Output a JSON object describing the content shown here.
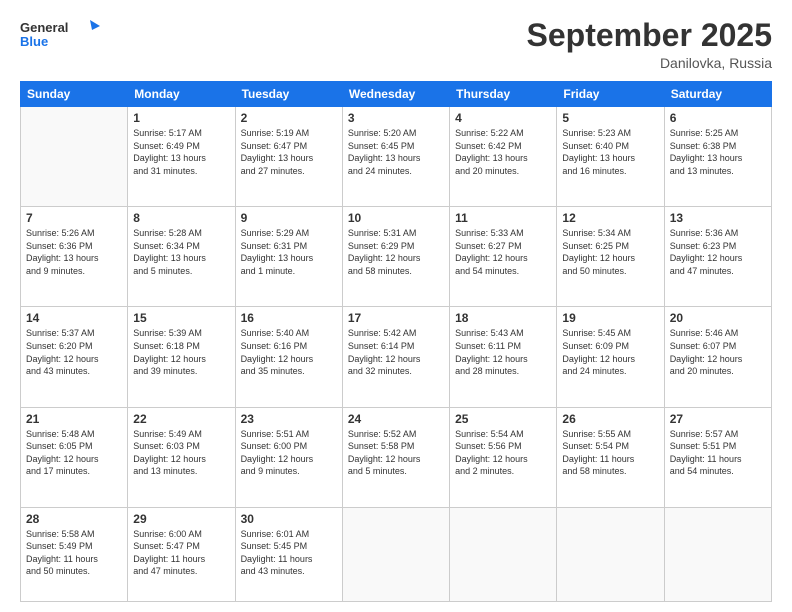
{
  "header": {
    "logo_line1": "General",
    "logo_line2": "Blue",
    "month": "September 2025",
    "location": "Danilovka, Russia"
  },
  "weekdays": [
    "Sunday",
    "Monday",
    "Tuesday",
    "Wednesday",
    "Thursday",
    "Friday",
    "Saturday"
  ],
  "weeks": [
    [
      {
        "day": "",
        "info": ""
      },
      {
        "day": "1",
        "info": "Sunrise: 5:17 AM\nSunset: 6:49 PM\nDaylight: 13 hours\nand 31 minutes."
      },
      {
        "day": "2",
        "info": "Sunrise: 5:19 AM\nSunset: 6:47 PM\nDaylight: 13 hours\nand 27 minutes."
      },
      {
        "day": "3",
        "info": "Sunrise: 5:20 AM\nSunset: 6:45 PM\nDaylight: 13 hours\nand 24 minutes."
      },
      {
        "day": "4",
        "info": "Sunrise: 5:22 AM\nSunset: 6:42 PM\nDaylight: 13 hours\nand 20 minutes."
      },
      {
        "day": "5",
        "info": "Sunrise: 5:23 AM\nSunset: 6:40 PM\nDaylight: 13 hours\nand 16 minutes."
      },
      {
        "day": "6",
        "info": "Sunrise: 5:25 AM\nSunset: 6:38 PM\nDaylight: 13 hours\nand 13 minutes."
      }
    ],
    [
      {
        "day": "7",
        "info": "Sunrise: 5:26 AM\nSunset: 6:36 PM\nDaylight: 13 hours\nand 9 minutes."
      },
      {
        "day": "8",
        "info": "Sunrise: 5:28 AM\nSunset: 6:34 PM\nDaylight: 13 hours\nand 5 minutes."
      },
      {
        "day": "9",
        "info": "Sunrise: 5:29 AM\nSunset: 6:31 PM\nDaylight: 13 hours\nand 1 minute."
      },
      {
        "day": "10",
        "info": "Sunrise: 5:31 AM\nSunset: 6:29 PM\nDaylight: 12 hours\nand 58 minutes."
      },
      {
        "day": "11",
        "info": "Sunrise: 5:33 AM\nSunset: 6:27 PM\nDaylight: 12 hours\nand 54 minutes."
      },
      {
        "day": "12",
        "info": "Sunrise: 5:34 AM\nSunset: 6:25 PM\nDaylight: 12 hours\nand 50 minutes."
      },
      {
        "day": "13",
        "info": "Sunrise: 5:36 AM\nSunset: 6:23 PM\nDaylight: 12 hours\nand 47 minutes."
      }
    ],
    [
      {
        "day": "14",
        "info": "Sunrise: 5:37 AM\nSunset: 6:20 PM\nDaylight: 12 hours\nand 43 minutes."
      },
      {
        "day": "15",
        "info": "Sunrise: 5:39 AM\nSunset: 6:18 PM\nDaylight: 12 hours\nand 39 minutes."
      },
      {
        "day": "16",
        "info": "Sunrise: 5:40 AM\nSunset: 6:16 PM\nDaylight: 12 hours\nand 35 minutes."
      },
      {
        "day": "17",
        "info": "Sunrise: 5:42 AM\nSunset: 6:14 PM\nDaylight: 12 hours\nand 32 minutes."
      },
      {
        "day": "18",
        "info": "Sunrise: 5:43 AM\nSunset: 6:11 PM\nDaylight: 12 hours\nand 28 minutes."
      },
      {
        "day": "19",
        "info": "Sunrise: 5:45 AM\nSunset: 6:09 PM\nDaylight: 12 hours\nand 24 minutes."
      },
      {
        "day": "20",
        "info": "Sunrise: 5:46 AM\nSunset: 6:07 PM\nDaylight: 12 hours\nand 20 minutes."
      }
    ],
    [
      {
        "day": "21",
        "info": "Sunrise: 5:48 AM\nSunset: 6:05 PM\nDaylight: 12 hours\nand 17 minutes."
      },
      {
        "day": "22",
        "info": "Sunrise: 5:49 AM\nSunset: 6:03 PM\nDaylight: 12 hours\nand 13 minutes."
      },
      {
        "day": "23",
        "info": "Sunrise: 5:51 AM\nSunset: 6:00 PM\nDaylight: 12 hours\nand 9 minutes."
      },
      {
        "day": "24",
        "info": "Sunrise: 5:52 AM\nSunset: 5:58 PM\nDaylight: 12 hours\nand 5 minutes."
      },
      {
        "day": "25",
        "info": "Sunrise: 5:54 AM\nSunset: 5:56 PM\nDaylight: 12 hours\nand 2 minutes."
      },
      {
        "day": "26",
        "info": "Sunrise: 5:55 AM\nSunset: 5:54 PM\nDaylight: 11 hours\nand 58 minutes."
      },
      {
        "day": "27",
        "info": "Sunrise: 5:57 AM\nSunset: 5:51 PM\nDaylight: 11 hours\nand 54 minutes."
      }
    ],
    [
      {
        "day": "28",
        "info": "Sunrise: 5:58 AM\nSunset: 5:49 PM\nDaylight: 11 hours\nand 50 minutes."
      },
      {
        "day": "29",
        "info": "Sunrise: 6:00 AM\nSunset: 5:47 PM\nDaylight: 11 hours\nand 47 minutes."
      },
      {
        "day": "30",
        "info": "Sunrise: 6:01 AM\nSunset: 5:45 PM\nDaylight: 11 hours\nand 43 minutes."
      },
      {
        "day": "",
        "info": ""
      },
      {
        "day": "",
        "info": ""
      },
      {
        "day": "",
        "info": ""
      },
      {
        "day": "",
        "info": ""
      }
    ]
  ]
}
